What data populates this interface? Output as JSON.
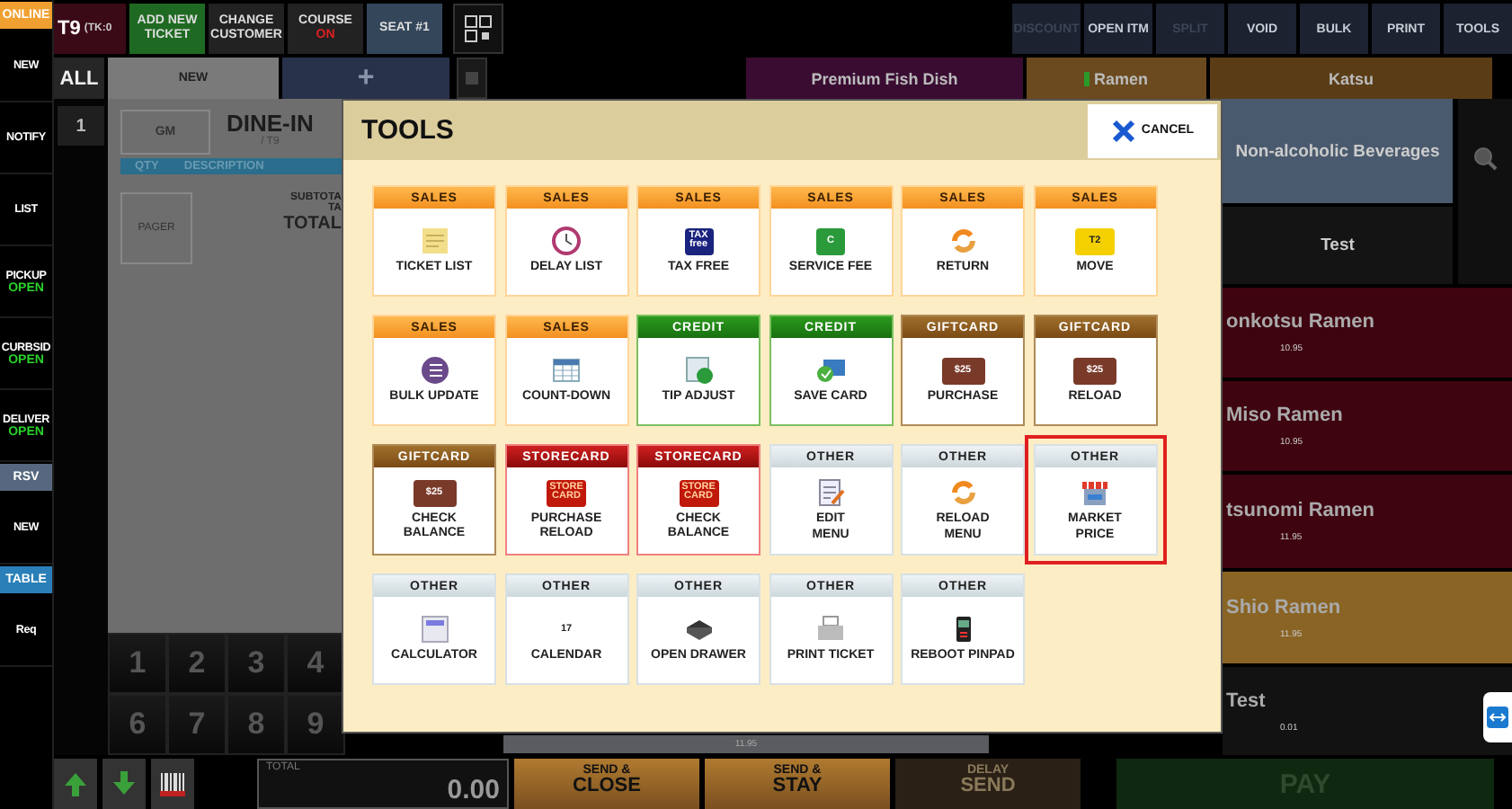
{
  "nav": [
    {
      "kind": "badge",
      "label": "ONLINE",
      "color": "#f0a030"
    },
    {
      "kind": "item",
      "label": "NEW"
    },
    {
      "kind": "item",
      "label": "NOTIFY"
    },
    {
      "kind": "item",
      "label": "LIST"
    },
    {
      "kind": "item",
      "label": "PICKUP",
      "status": "OPEN"
    },
    {
      "kind": "item",
      "label": "CURBSID",
      "status": "OPEN"
    },
    {
      "kind": "item",
      "label": "DELIVER",
      "status": "OPEN"
    },
    {
      "kind": "badge",
      "label": "RSV",
      "color": "#56677f"
    },
    {
      "kind": "item",
      "label": "NEW"
    },
    {
      "kind": "badge",
      "label": "TABLE",
      "color": "#2a7fb8"
    },
    {
      "kind": "item",
      "label": "Req"
    }
  ],
  "ticket": {
    "number": "T9",
    "code": "(TK:0"
  },
  "top_buttons": [
    {
      "label": "ADD NEW TICKET",
      "color": "#1f6a22"
    },
    {
      "label": "CHANGE CUSTOMER",
      "color": "#222222"
    },
    {
      "label": "COURSE",
      "status": "ON",
      "color": "#222222"
    },
    {
      "label": "SEAT #1",
      "color": "#34465a"
    }
  ],
  "actions": [
    {
      "label": "DISCOUNT",
      "disabled": true
    },
    {
      "label": "OPEN ITM",
      "disabled": false
    },
    {
      "label": "SPLIT",
      "disabled": true
    },
    {
      "label": "VOID",
      "disabled": false
    },
    {
      "label": "BULK",
      "disabled": false
    },
    {
      "label": "PRINT",
      "disabled": false
    },
    {
      "label": "TOOLS",
      "disabled": false
    }
  ],
  "tabs": [
    {
      "label": "ALL",
      "selected": true
    },
    {
      "label": "NEW",
      "selected": false
    }
  ],
  "add_tab": "+",
  "categories": [
    {
      "label": "Premium Fish Dish",
      "color": "#3a0c32",
      "marked": false
    },
    {
      "label": "Ramen",
      "color": "#6a4a1e",
      "marked": true
    },
    {
      "label": "Katsu",
      "color": "#5a3c16",
      "marked": false
    }
  ],
  "ticket_panel": {
    "seat": "1",
    "guest": "GM",
    "order_type": "DINE-IN",
    "table": "/ T9",
    "columns": [
      "QTY",
      "DESCRIPTION"
    ],
    "pager": "PAGER",
    "summary": [
      "SUBTOTA",
      "TA",
      "TOTAL"
    ]
  },
  "keypad": [
    "1",
    "2",
    "3",
    "4",
    "6",
    "7",
    "8",
    "9"
  ],
  "modal": {
    "title": "TOOLS",
    "cancel": "CANCEL",
    "tiles": [
      {
        "kind": "sales",
        "category": "SALES",
        "label": "TICKET LIST",
        "highlighted": false
      },
      {
        "kind": "sales",
        "category": "SALES",
        "label": "DELAY LIST",
        "highlighted": false
      },
      {
        "kind": "sales",
        "category": "SALES",
        "label": "TAX FREE",
        "icon_text": "TAX free",
        "highlighted": false
      },
      {
        "kind": "sales",
        "category": "SALES",
        "label": "SERVICE FEE",
        "icon_text": "C",
        "highlighted": false
      },
      {
        "kind": "sales",
        "category": "SALES",
        "label": "RETURN",
        "highlighted": false
      },
      {
        "kind": "sales",
        "category": "SALES",
        "label": "MOVE",
        "icon_text": "T2",
        "highlighted": false
      },
      {
        "kind": "sales",
        "category": "SALES",
        "label": "BULK UPDATE",
        "highlighted": false
      },
      {
        "kind": "sales",
        "category": "SALES",
        "label": "COUNT-DOWN",
        "highlighted": false
      },
      {
        "kind": "credit",
        "category": "CREDIT",
        "label": "TIP ADJUST",
        "highlighted": false
      },
      {
        "kind": "credit",
        "category": "CREDIT",
        "label": "SAVE CARD",
        "highlighted": false
      },
      {
        "kind": "giftcard",
        "category": "GIFTCARD",
        "label": "PURCHASE",
        "icon_text": "$25",
        "highlighted": false
      },
      {
        "kind": "giftcard",
        "category": "GIFTCARD",
        "label": "RELOAD",
        "icon_text": "$25",
        "highlighted": false
      },
      {
        "kind": "giftcard",
        "category": "GIFTCARD",
        "label": "CHECK\nBALANCE",
        "icon_text": "$25",
        "highlighted": false
      },
      {
        "kind": "storecard",
        "category": "STORECARD",
        "label": "PURCHASE\nRELOAD",
        "icon_text": "STORE CARD",
        "highlighted": false
      },
      {
        "kind": "storecard",
        "category": "STORECARD",
        "label": "CHECK\nBALANCE",
        "icon_text": "STORE CARD",
        "highlighted": false
      },
      {
        "kind": "other",
        "category": "OTHER",
        "label": "EDIT\nMENU",
        "highlighted": false
      },
      {
        "kind": "other",
        "category": "OTHER",
        "label": "RELOAD\nMENU",
        "highlighted": false
      },
      {
        "kind": "other",
        "category": "OTHER",
        "label": "MARKET\nPRICE",
        "highlighted": true
      },
      {
        "kind": "other",
        "category": "OTHER",
        "label": "CALCULATOR",
        "highlighted": false
      },
      {
        "kind": "other",
        "category": "OTHER",
        "label": "CALENDAR",
        "icon_text": "17",
        "highlighted": false
      },
      {
        "kind": "other",
        "category": "OTHER",
        "label": "OPEN DRAWER",
        "highlighted": false
      },
      {
        "kind": "other",
        "category": "OTHER",
        "label": "PRINT TICKET",
        "highlighted": false
      },
      {
        "kind": "other",
        "category": "OTHER",
        "label": "REBOOT PINPAD",
        "highlighted": false
      }
    ]
  },
  "strip": {
    "price": "11.95"
  },
  "side": {
    "groups": [
      {
        "label": "Non-alcoholic Beverages",
        "color": "#4a5a6e"
      },
      {
        "label": "Test",
        "color": "#141414"
      }
    ],
    "items": [
      {
        "name": "onkotsu Ramen",
        "price": "10.95",
        "color": "#3e0410"
      },
      {
        "name": "Miso Ramen",
        "price": "10.95",
        "color": "#3e0410"
      },
      {
        "name": "tsunomi Ramen",
        "price": "11.95",
        "color": "#3e0410"
      },
      {
        "name": "Shio Ramen",
        "price": "11.95",
        "color": "#8a6424"
      },
      {
        "name": "Test",
        "price": "0.01",
        "color": "#121212"
      }
    ]
  },
  "bottom": {
    "total_label": "TOTAL",
    "total": "0.00",
    "buttons": [
      {
        "label": "SEND &",
        "sub": "CLOSE",
        "disabled": false
      },
      {
        "label": "SEND &",
        "sub": "STAY",
        "disabled": false
      },
      {
        "label": "DELAY",
        "sub": "SEND",
        "disabled": true
      }
    ],
    "pay": "PAY"
  }
}
